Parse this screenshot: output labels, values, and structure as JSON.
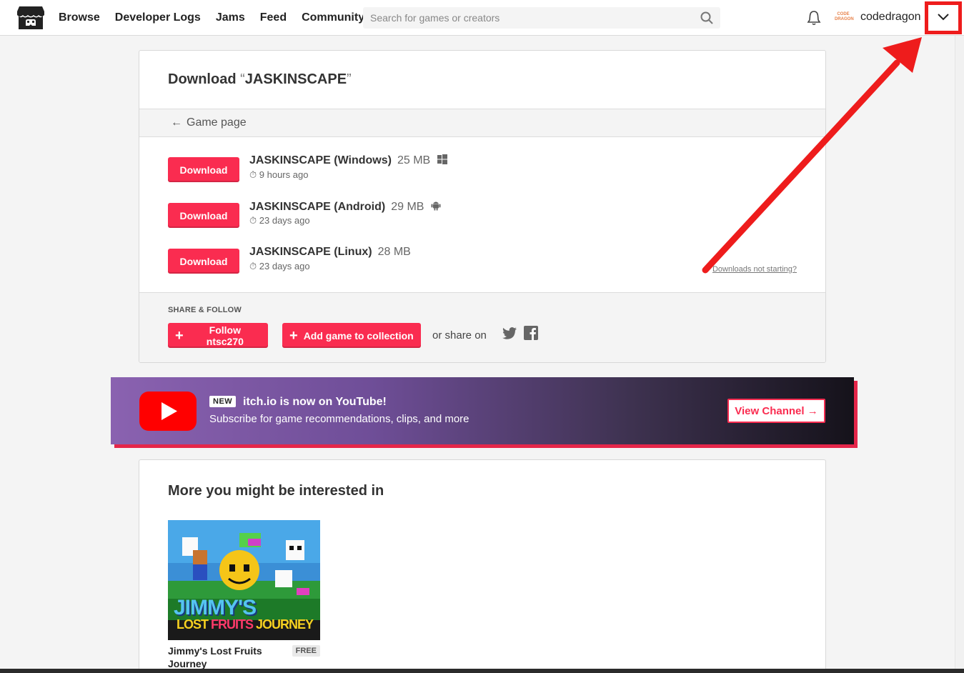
{
  "header": {
    "nav": [
      "Browse",
      "Developer Logs",
      "Jams",
      "Feed",
      "Community"
    ],
    "search_placeholder": "Search for games or creators",
    "avatar_text": "CODE DRAGON",
    "username": "codedragon"
  },
  "download_panel": {
    "title_prefix": "Download ",
    "open_quote": "“",
    "game_name": "JASKINSCAPE",
    "close_quote": "”",
    "back_link": "Game page",
    "uploads": [
      {
        "button": "Download",
        "name": "JASKINSCAPE (Windows)",
        "size": "25 MB",
        "platform_icon": "windows-icon",
        "date": "9 hours ago"
      },
      {
        "button": "Download",
        "name": "JASKINSCAPE (Android)",
        "size": "29 MB",
        "platform_icon": "android-icon",
        "date": "23 days ago"
      },
      {
        "button": "Download",
        "name": "JASKINSCAPE (Linux)",
        "size": "28 MB",
        "platform_icon": "",
        "date": "23 days ago"
      }
    ],
    "problem_link": "Downloads not starting?"
  },
  "share": {
    "heading": "SHARE & FOLLOW",
    "follow_button": "Follow ntsc270",
    "collection_button": "Add game to collection",
    "share_on": "or share on"
  },
  "youtube_banner": {
    "badge": "NEW",
    "title": "itch.io is now on YouTube!",
    "subtitle": "Subscribe for game recommendations, clips, and more",
    "button": "View Channel →"
  },
  "recommendations": {
    "title": "More you might be interested in",
    "games": [
      {
        "title": "Jimmy's Lost Fruits Journey",
        "price": "FREE",
        "thumb_text_1": "JIMMY'S",
        "thumb_text_2a": "LOST ",
        "thumb_text_2b": "FRUITS",
        "thumb_text_2c": " JOURNEY"
      }
    ]
  },
  "colors": {
    "accent": "#fa2c50",
    "annotation": "#ee1c1c",
    "banner_start": "#8a62b0"
  }
}
